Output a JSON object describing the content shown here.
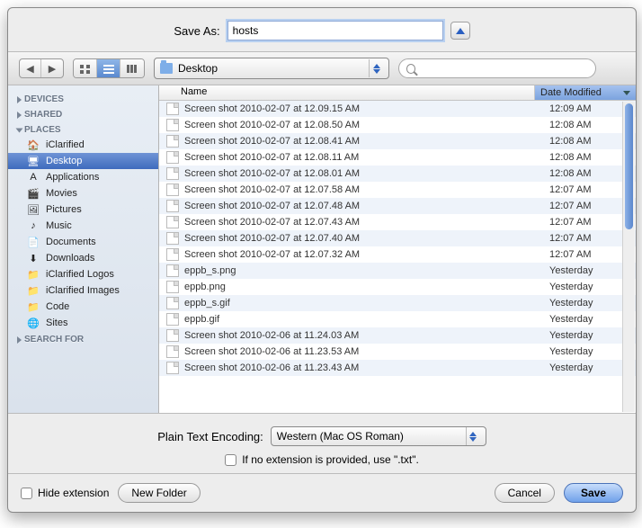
{
  "saveAs": {
    "label": "Save As:",
    "value": "hosts"
  },
  "toolbar": {
    "location": "Desktop",
    "searchPlaceholder": ""
  },
  "sidebar": {
    "sections": [
      {
        "title": "DEVICES",
        "open": false,
        "items": []
      },
      {
        "title": "SHARED",
        "open": false,
        "items": []
      },
      {
        "title": "PLACES",
        "open": true,
        "items": [
          {
            "icon": "home-icon",
            "label": "iClarified",
            "selected": false
          },
          {
            "icon": "desktop-icon",
            "label": "Desktop",
            "selected": true
          },
          {
            "icon": "apps-icon",
            "label": "Applications",
            "selected": false
          },
          {
            "icon": "movies-icon",
            "label": "Movies",
            "selected": false
          },
          {
            "icon": "pictures-icon",
            "label": "Pictures",
            "selected": false
          },
          {
            "icon": "music-icon",
            "label": "Music",
            "selected": false
          },
          {
            "icon": "documents-icon",
            "label": "Documents",
            "selected": false
          },
          {
            "icon": "downloads-icon",
            "label": "Downloads",
            "selected": false
          },
          {
            "icon": "folder-icon",
            "label": "iClarified Logos",
            "selected": false
          },
          {
            "icon": "folder-icon",
            "label": "iClarified Images",
            "selected": false
          },
          {
            "icon": "folder-icon",
            "label": "Code",
            "selected": false
          },
          {
            "icon": "sites-icon",
            "label": "Sites",
            "selected": false
          }
        ]
      },
      {
        "title": "SEARCH FOR",
        "open": false,
        "items": []
      }
    ]
  },
  "columns": {
    "name": "Name",
    "date": "Date Modified"
  },
  "files": [
    {
      "name": "Screen shot 2010-02-07 at 12.09.15 AM",
      "date": "12:09 AM"
    },
    {
      "name": "Screen shot 2010-02-07 at 12.08.50 AM",
      "date": "12:08 AM"
    },
    {
      "name": "Screen shot 2010-02-07 at 12.08.41 AM",
      "date": "12:08 AM"
    },
    {
      "name": "Screen shot 2010-02-07 at 12.08.11 AM",
      "date": "12:08 AM"
    },
    {
      "name": "Screen shot 2010-02-07 at 12.08.01 AM",
      "date": "12:08 AM"
    },
    {
      "name": "Screen shot 2010-02-07 at 12.07.58 AM",
      "date": "12:07 AM"
    },
    {
      "name": "Screen shot 2010-02-07 at 12.07.48 AM",
      "date": "12:07 AM"
    },
    {
      "name": "Screen shot 2010-02-07 at 12.07.43 AM",
      "date": "12:07 AM"
    },
    {
      "name": "Screen shot 2010-02-07 at 12.07.40 AM",
      "date": "12:07 AM"
    },
    {
      "name": "Screen shot 2010-02-07 at 12.07.32 AM",
      "date": "12:07 AM"
    },
    {
      "name": "eppb_s.png",
      "date": "Yesterday"
    },
    {
      "name": "eppb.png",
      "date": "Yesterday"
    },
    {
      "name": "eppb_s.gif",
      "date": "Yesterday"
    },
    {
      "name": "eppb.gif",
      "date": "Yesterday"
    },
    {
      "name": "Screen shot 2010-02-06 at 11.24.03 AM",
      "date": "Yesterday"
    },
    {
      "name": "Screen shot 2010-02-06 at 11.23.53 AM",
      "date": "Yesterday"
    },
    {
      "name": "Screen shot 2010-02-06 at 11.23.43 AM",
      "date": "Yesterday"
    }
  ],
  "encoding": {
    "label": "Plain Text Encoding:",
    "value": "Western (Mac OS Roman)",
    "extCheckLabel": "If no extension is provided, use \".txt\"."
  },
  "bottom": {
    "hideExt": "Hide extension",
    "newFolder": "New Folder",
    "cancel": "Cancel",
    "save": "Save"
  },
  "icons": {
    "home-icon": "🏠",
    "desktop-icon": "🖥",
    "apps-icon": "A",
    "movies-icon": "🎬",
    "pictures-icon": "🖼",
    "music-icon": "♪",
    "documents-icon": "📄",
    "downloads-icon": "⬇",
    "folder-icon": "📁",
    "sites-icon": "🌐"
  }
}
